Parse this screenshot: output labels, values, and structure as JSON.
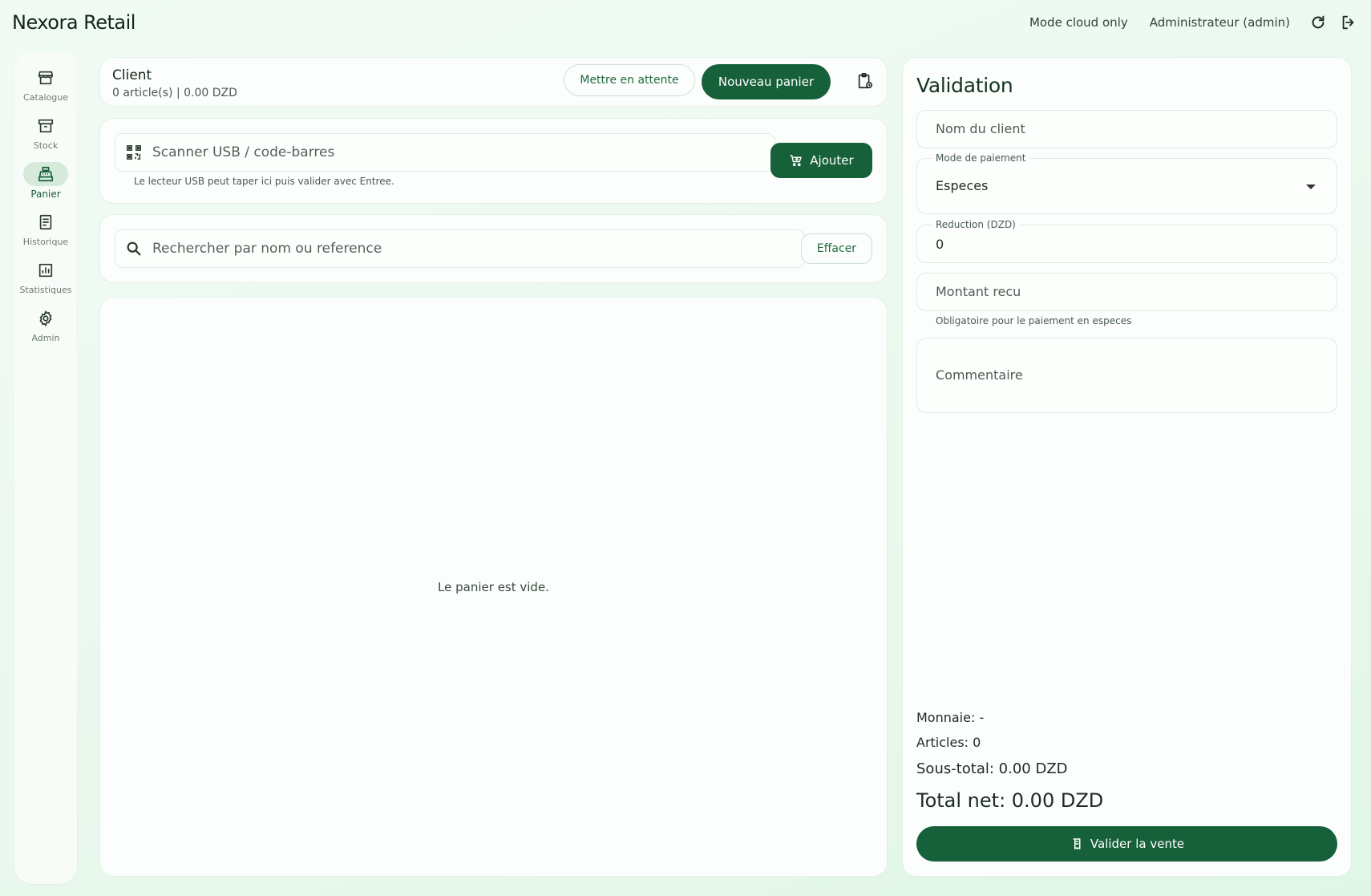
{
  "app": {
    "title": "Nexora Retail"
  },
  "topbar": {
    "mode": "Mode cloud only",
    "user": "Administrateur (admin)"
  },
  "sidebar": {
    "items": [
      {
        "label": "Catalogue",
        "icon": "storefront-icon",
        "active": false
      },
      {
        "label": "Stock",
        "icon": "archive-box-icon",
        "active": false
      },
      {
        "label": "Panier",
        "icon": "cash-register-icon",
        "active": true
      },
      {
        "label": "Historique",
        "icon": "receipt-list-icon",
        "active": false
      },
      {
        "label": "Statistiques",
        "icon": "bar-chart-icon",
        "active": false
      },
      {
        "label": "Admin",
        "icon": "gear-icon",
        "active": false
      }
    ]
  },
  "client": {
    "title": "Client",
    "summary": "0 article(s) | 0.00 DZD",
    "hold_label": "Mettre en attente",
    "new_cart_label": "Nouveau panier"
  },
  "scanner": {
    "placeholder": "Scanner USB / code-barres",
    "add_label": "Ajouter",
    "helper": "Le lecteur USB peut taper ici puis valider avec Entree."
  },
  "search": {
    "placeholder": "Rechercher par nom ou reference",
    "clear_label": "Effacer"
  },
  "cart": {
    "empty_message": "Le panier est vide."
  },
  "validation": {
    "title": "Validation",
    "customer_placeholder": "Nom du client",
    "payment_label": "Mode de paiement",
    "payment_value": "Especes",
    "discount_label": "Reduction (DZD)",
    "discount_value": "0",
    "received_placeholder": "Montant recu",
    "received_helper": "Obligatoire pour le paiement en especes",
    "comment_placeholder": "Commentaire",
    "change": "Monnaie: -",
    "items": "Articles: 0",
    "subtotal": "Sous-total: 0.00 DZD",
    "total": "Total net: 0.00 DZD",
    "submit_label": "Valider la vente"
  },
  "colors": {
    "accent": "#17613a",
    "background": "#eaf8ee"
  }
}
